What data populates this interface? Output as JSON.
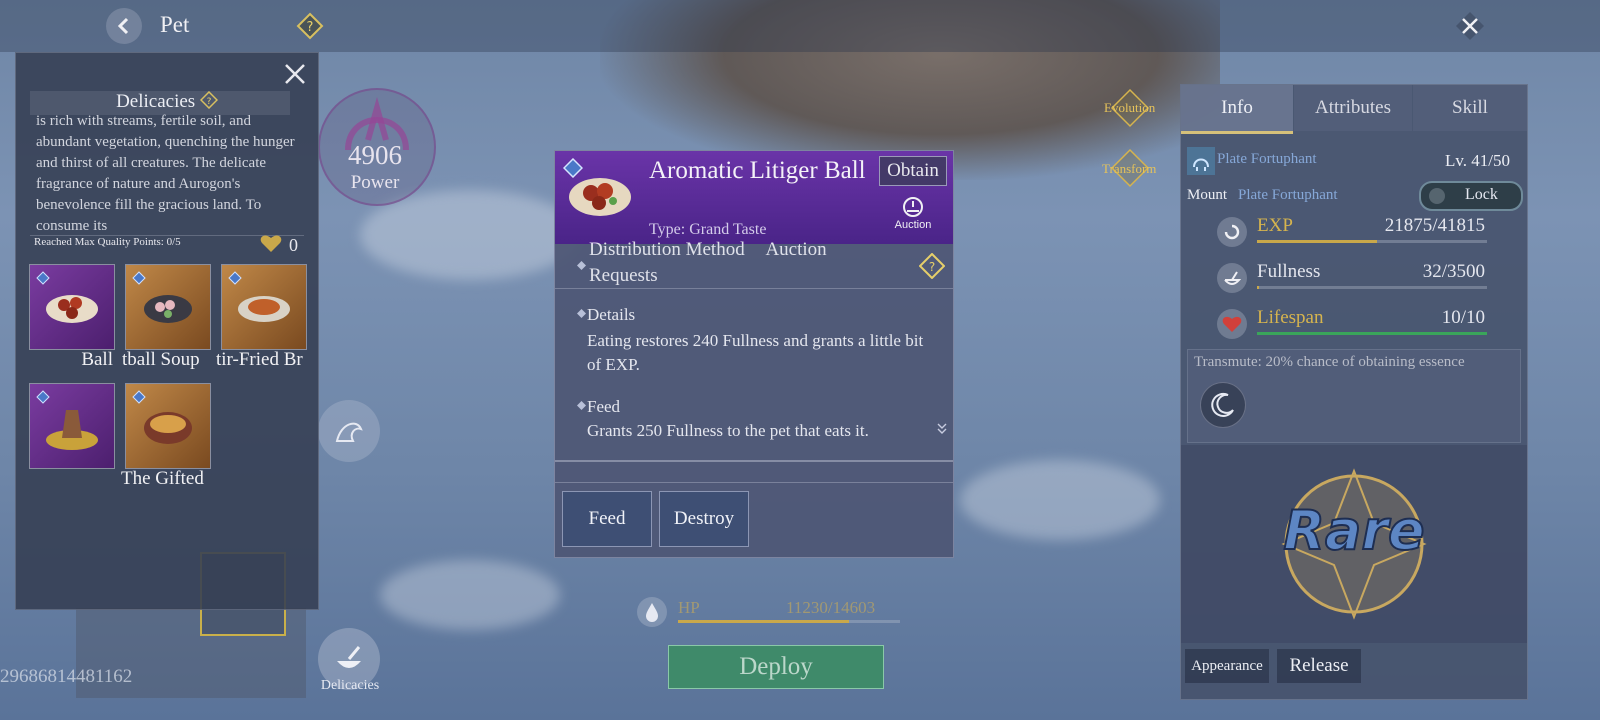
{
  "header": {
    "title": "Pet"
  },
  "delicacies_panel": {
    "title": "Delicacies",
    "description": "is rich with streams, fertile soil, and abundant vegetation, quenching the hunger and thirst of all creatures. The delicate fragrance of nature and Aurogon's benevolence fill the gracious land. To consume its",
    "quality_text": "Reached Max Quality Points: 0/5",
    "hearts": "0",
    "items": [
      {
        "label": "Ball",
        "color": "#6a2c8c"
      },
      {
        "label": "tball Soup",
        "color": "#b0763a"
      },
      {
        "label": "tir-Fried Br",
        "color": "#b0763a"
      },
      {
        "label": "",
        "color": "#6a2c8c"
      },
      {
        "label": "The Gifted",
        "color": "#b0763a"
      }
    ]
  },
  "power": {
    "value": "4906",
    "label": "Power"
  },
  "bottom_left": {
    "id_number": "29686814481162",
    "delicacies_label": "Delicacies"
  },
  "world_buttons": {
    "evolution": "Evolution",
    "transform": "Transform"
  },
  "item_popup": {
    "name": "Aromatic Litiger Ball",
    "obtain": "Obtain",
    "type": "Type: Grand Taste",
    "auction_label": "Auction",
    "distribution_heading": "Distribution Method",
    "distribution_value": "Auction",
    "distribution_line2": "Requests",
    "details_heading": "Details",
    "details_text": "Eating restores 240 Fullness and grants a little bit of EXP.",
    "feed_heading": "Feed",
    "feed_text": "Grants 250 Fullness to the pet that eats it.",
    "feed_button": "Feed",
    "destroy_button": "Destroy"
  },
  "hp": {
    "label": "HP",
    "value": "11230/14603",
    "fraction": 0.769
  },
  "deploy_button": "Deploy",
  "info_panel": {
    "tabs": [
      "Info",
      "Attributes",
      "Skill"
    ],
    "active_tab": "Info",
    "pet_name": "Plate Fortuphant",
    "level": "Lv. 41/50",
    "mount_label": "Mount",
    "mount_name": "Plate Fortuphant",
    "lock_label": "Lock",
    "stats": [
      {
        "name": "EXP",
        "value": "21875/41815",
        "fraction": 0.523,
        "color": "#c9a84a"
      },
      {
        "name": "Fullness",
        "value": "32/3500",
        "fraction": 0.009,
        "color": "#c9a84a"
      },
      {
        "name": "Lifespan",
        "value": "10/10",
        "fraction": 1.0,
        "color": "#3aa55a"
      }
    ],
    "transmute_text": "Transmute: 20% chance of obtaining essence",
    "rarity": "Rare",
    "appearance_button": "Appearance",
    "release_button": "Release"
  }
}
